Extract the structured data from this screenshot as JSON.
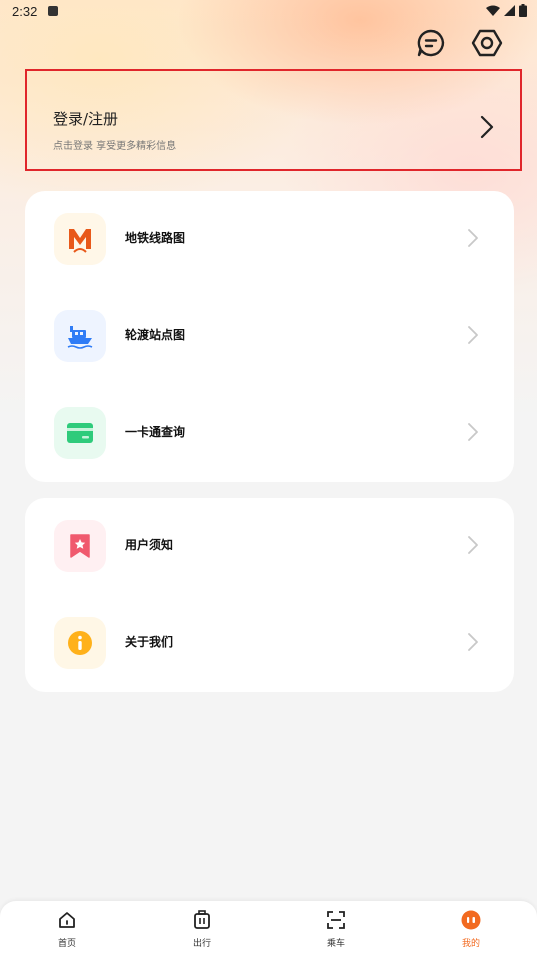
{
  "status_bar": {
    "time": "2:32"
  },
  "header": {
    "message_icon": "message-icon",
    "settings_icon": "settings-gear-icon"
  },
  "login": {
    "title": "登录/注册",
    "subtitle": "点击登录 享受更多精彩信息"
  },
  "menu_group_1": [
    {
      "label": "地铁线路图",
      "icon": "metro-logo-icon",
      "icon_color": "#e8591a",
      "icon_bg": "#fff7e8"
    },
    {
      "label": "轮渡站点图",
      "icon": "ferry-icon",
      "icon_color": "#2f7cf6",
      "icon_bg": "#eef4ff"
    },
    {
      "label": "一卡通查询",
      "icon": "card-icon",
      "icon_color": "#2ecb7b",
      "icon_bg": "#e8faf0"
    }
  ],
  "menu_group_2": [
    {
      "label": "用户须知",
      "icon": "bookmark-star-icon",
      "icon_color": "#f05a6e",
      "icon_bg": "#fff0f2"
    },
    {
      "label": "关于我们",
      "icon": "info-icon",
      "icon_color": "#ffb11a",
      "icon_bg": "#fff7e6"
    }
  ],
  "bottom_nav": [
    {
      "label": "首页",
      "icon": "home-icon"
    },
    {
      "label": "出行",
      "icon": "luggage-icon"
    },
    {
      "label": "乘车",
      "icon": "scan-icon"
    },
    {
      "label": "我的",
      "icon": "profile-icon",
      "active": true
    }
  ],
  "colors": {
    "accent": "#f26a20",
    "highlight_border": "#e0262b"
  }
}
